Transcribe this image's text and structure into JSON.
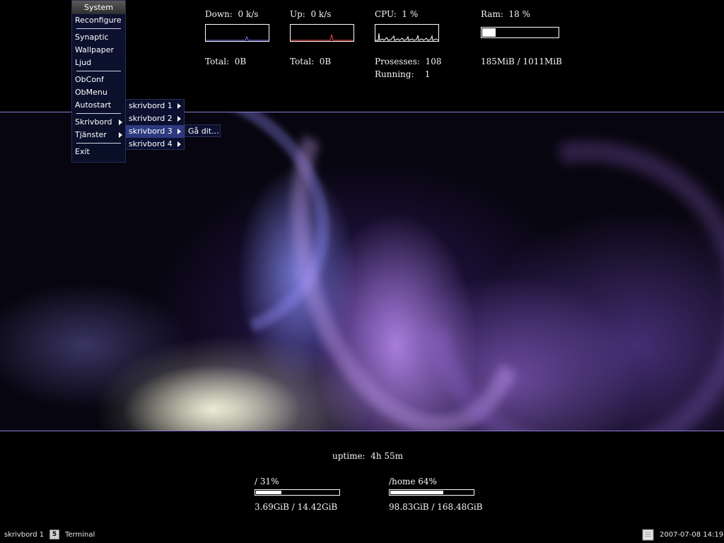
{
  "monitors": {
    "down": {
      "label": "Down:",
      "value": "0 k/s",
      "total_label": "Total:",
      "total_value": "0B"
    },
    "up": {
      "label": "Up:",
      "value": "0 k/s",
      "total_label": "Total:",
      "total_value": "0B"
    },
    "cpu": {
      "label": "CPU:",
      "value": "1 %",
      "processes_label": "Prosesses:",
      "processes_value": "108",
      "running_label": "Running:",
      "running_value": "1"
    },
    "ram": {
      "label": "Ram:",
      "value": "18 %",
      "usage": "185MiB  /  1011MiB",
      "fraction": 0.18
    },
    "uptime": {
      "label": "uptime:",
      "value": "4h 55m"
    },
    "disk_root": {
      "label": "/  31%",
      "usage": "3.69GiB  /  14.42GiB",
      "fraction": 0.31
    },
    "disk_home": {
      "label": "/home  64%",
      "usage": "98.83GiB  /  168.48GiB",
      "fraction": 0.64
    }
  },
  "menu": {
    "title": "System",
    "items": [
      "Reconfigure",
      "Synaptic",
      "Wallpaper",
      "Ljud",
      "ObConf",
      "ObMenu",
      "Autostart",
      "Skrivbord",
      "Tjänster",
      "Exit"
    ],
    "desktops": [
      "skrivbord 1",
      "skrivbord 2",
      "skrivbord 3",
      "skrivbord 4"
    ],
    "goto": "Gå dit..."
  },
  "panel": {
    "desktop": "skrivbord 1",
    "terminal_icon_glyph": "5",
    "terminal": "Terminal",
    "clock": "2007-07-08 14:19"
  },
  "colors": {
    "accent": "#8c7ad8",
    "menu_bg": "#0c1230",
    "menu_active": "#2d3a80",
    "down_graph": "#6f6fff",
    "up_graph": "#ff4040"
  }
}
